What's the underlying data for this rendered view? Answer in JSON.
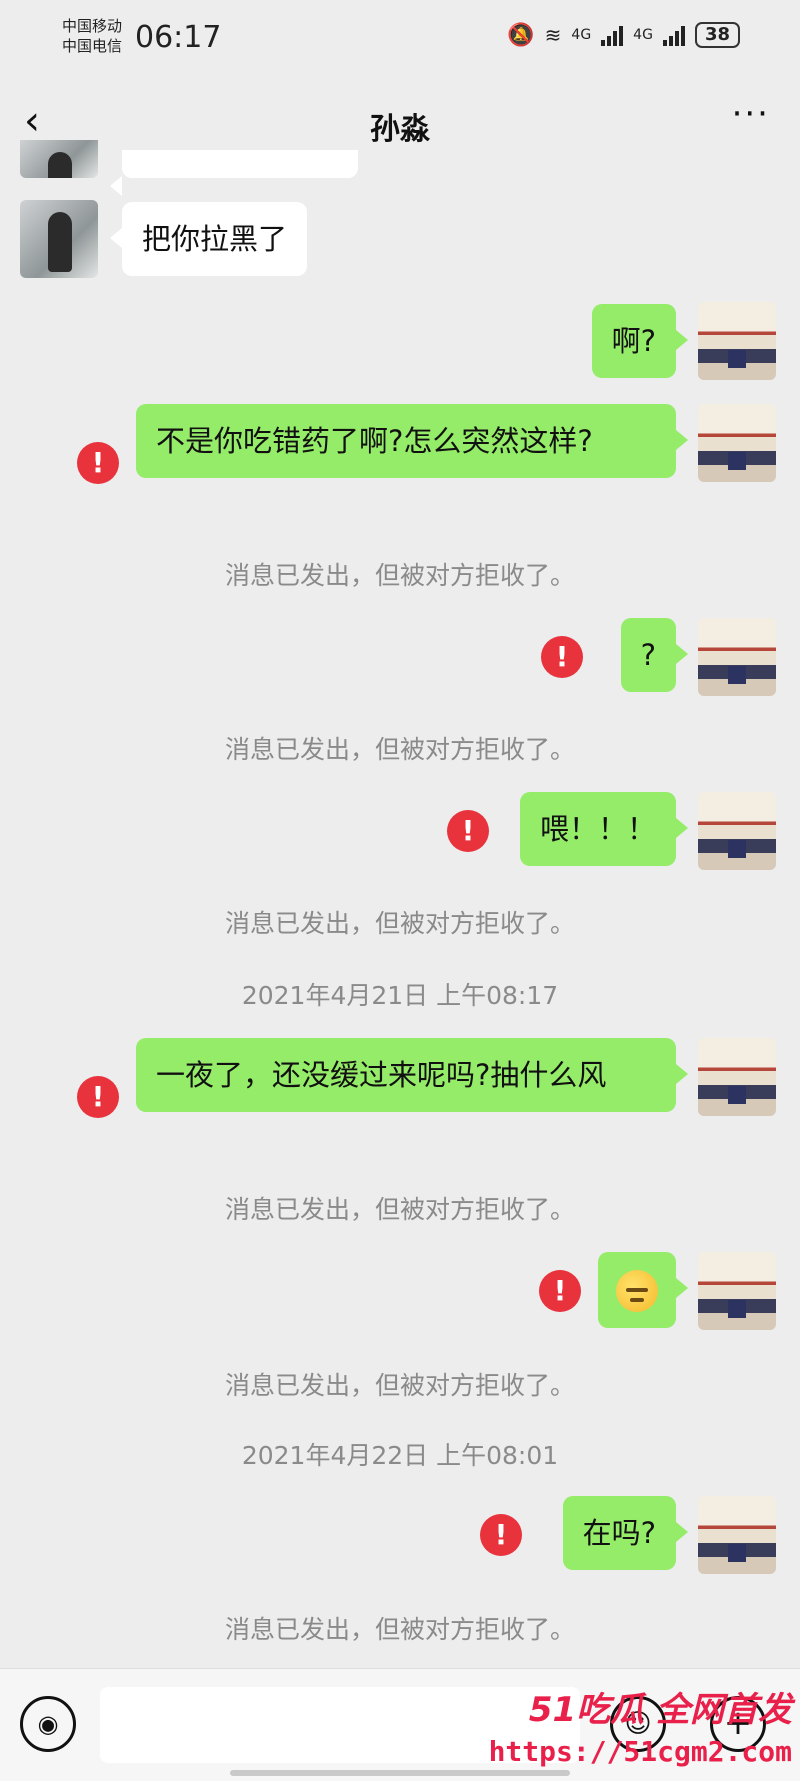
{
  "status_bar": {
    "carrier_1": "中国移动",
    "carrier_2": "中国电信",
    "time": "06:17",
    "network_1": "4G",
    "network_2": "4G",
    "battery": "38",
    "icons": [
      "mute-bell-icon",
      "wifi-icon",
      "signal-icon",
      "signal-icon",
      "battery-icon"
    ]
  },
  "nav": {
    "back_icon": "‹",
    "title": "孙淼",
    "more_icon": "···"
  },
  "messages": [
    {
      "side": "other",
      "text": "把你拉黑了"
    },
    {
      "side": "me",
      "text": "啊?"
    },
    {
      "side": "me",
      "text": "不是你吃错药了啊?怎么突然这样?",
      "error": true,
      "notice": "消息已发出，但被对方拒收了。"
    },
    {
      "side": "me",
      "text": "?",
      "error": true,
      "notice": "消息已发出，但被对方拒收了。"
    },
    {
      "side": "me",
      "text": "喂！！！",
      "error": true,
      "notice": "消息已发出，但被对方拒收了。"
    },
    {
      "timestamp": "2021年4月21日 上午08:17"
    },
    {
      "side": "me",
      "text": "一夜了，还没缓过来呢吗?抽什么风",
      "error": true,
      "notice": "消息已发出，但被对方拒收了。"
    },
    {
      "side": "me",
      "emoji": "sweat-smile-emoji",
      "error": true,
      "notice": "消息已发出，但被对方拒收了。"
    },
    {
      "timestamp": "2021年4月22日 上午08:01"
    },
    {
      "side": "me",
      "text": "在吗?",
      "error": true,
      "notice": "消息已发出，但被对方拒收了。"
    }
  ],
  "error_mark": "!",
  "input_bar": {
    "voice_icon": "voice-icon",
    "emoji_icon": "emoji-icon",
    "plus_icon": "plus-icon",
    "input_value": ""
  },
  "watermark": {
    "line1": "51吃瓜 全网首发",
    "url": "https://51cgm2.com"
  },
  "colors": {
    "my_bubble": "#95ec69",
    "other_bubble": "#ffffff",
    "background": "#ededed",
    "error": "#e8323c",
    "watermark": "#e8204a"
  }
}
